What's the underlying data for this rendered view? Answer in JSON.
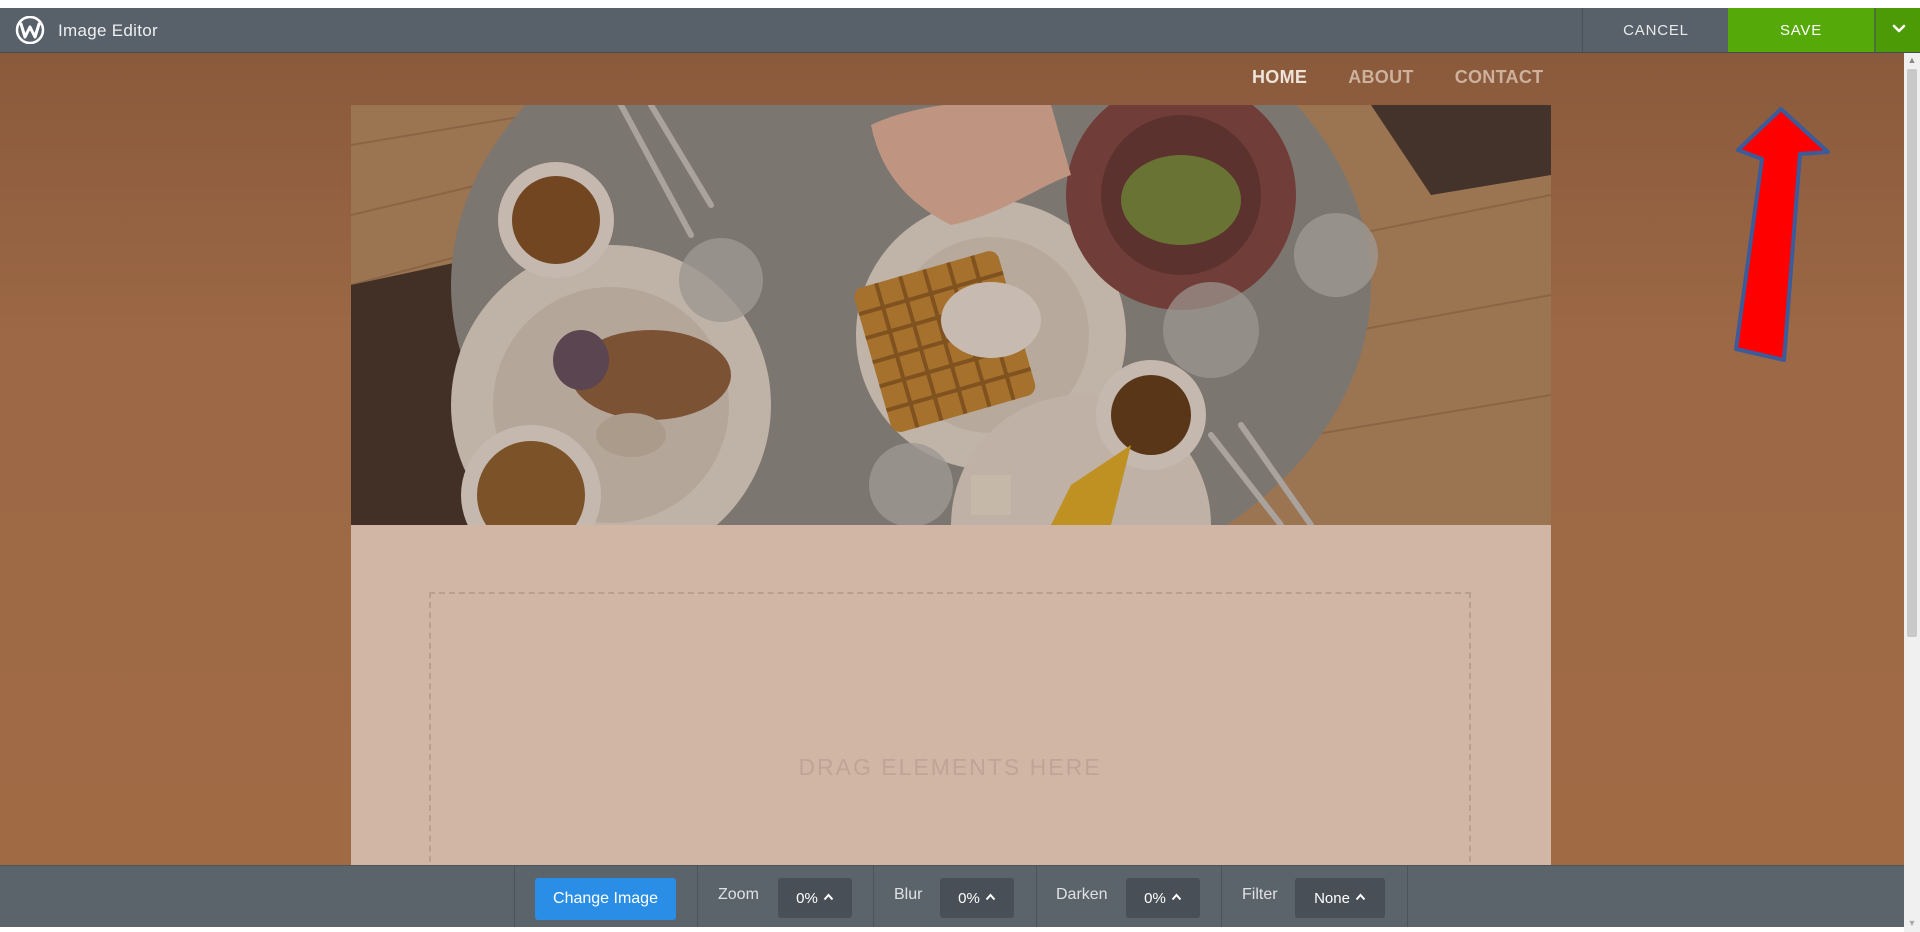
{
  "editor": {
    "title": "Image Editor",
    "cancel_label": "CANCEL",
    "save_label": "SAVE"
  },
  "site_nav": {
    "items": [
      {
        "label": "HOME"
      },
      {
        "label": "ABOUT"
      },
      {
        "label": "CONTACT"
      }
    ]
  },
  "content": {
    "drop_zone_text": "DRAG ELEMENTS HERE"
  },
  "toolbar": {
    "change_image_label": "Change Image",
    "zoom_label": "Zoom",
    "zoom_value": "0%",
    "blur_label": "Blur",
    "blur_value": "0%",
    "darken_label": "Darken",
    "darken_value": "0%",
    "filter_label": "Filter",
    "filter_value": "None"
  },
  "colors": {
    "save_green": "#55a908",
    "change_image_blue": "#2a8ee6",
    "topbar": "#58606a",
    "canvas_brown": "#9c6845",
    "annotation_arrow": "#ff0000"
  },
  "icons": {
    "logo": "weebly-logo-icon",
    "save_menu": "chevron-down-icon",
    "select_caret": "caret-up-icon"
  }
}
